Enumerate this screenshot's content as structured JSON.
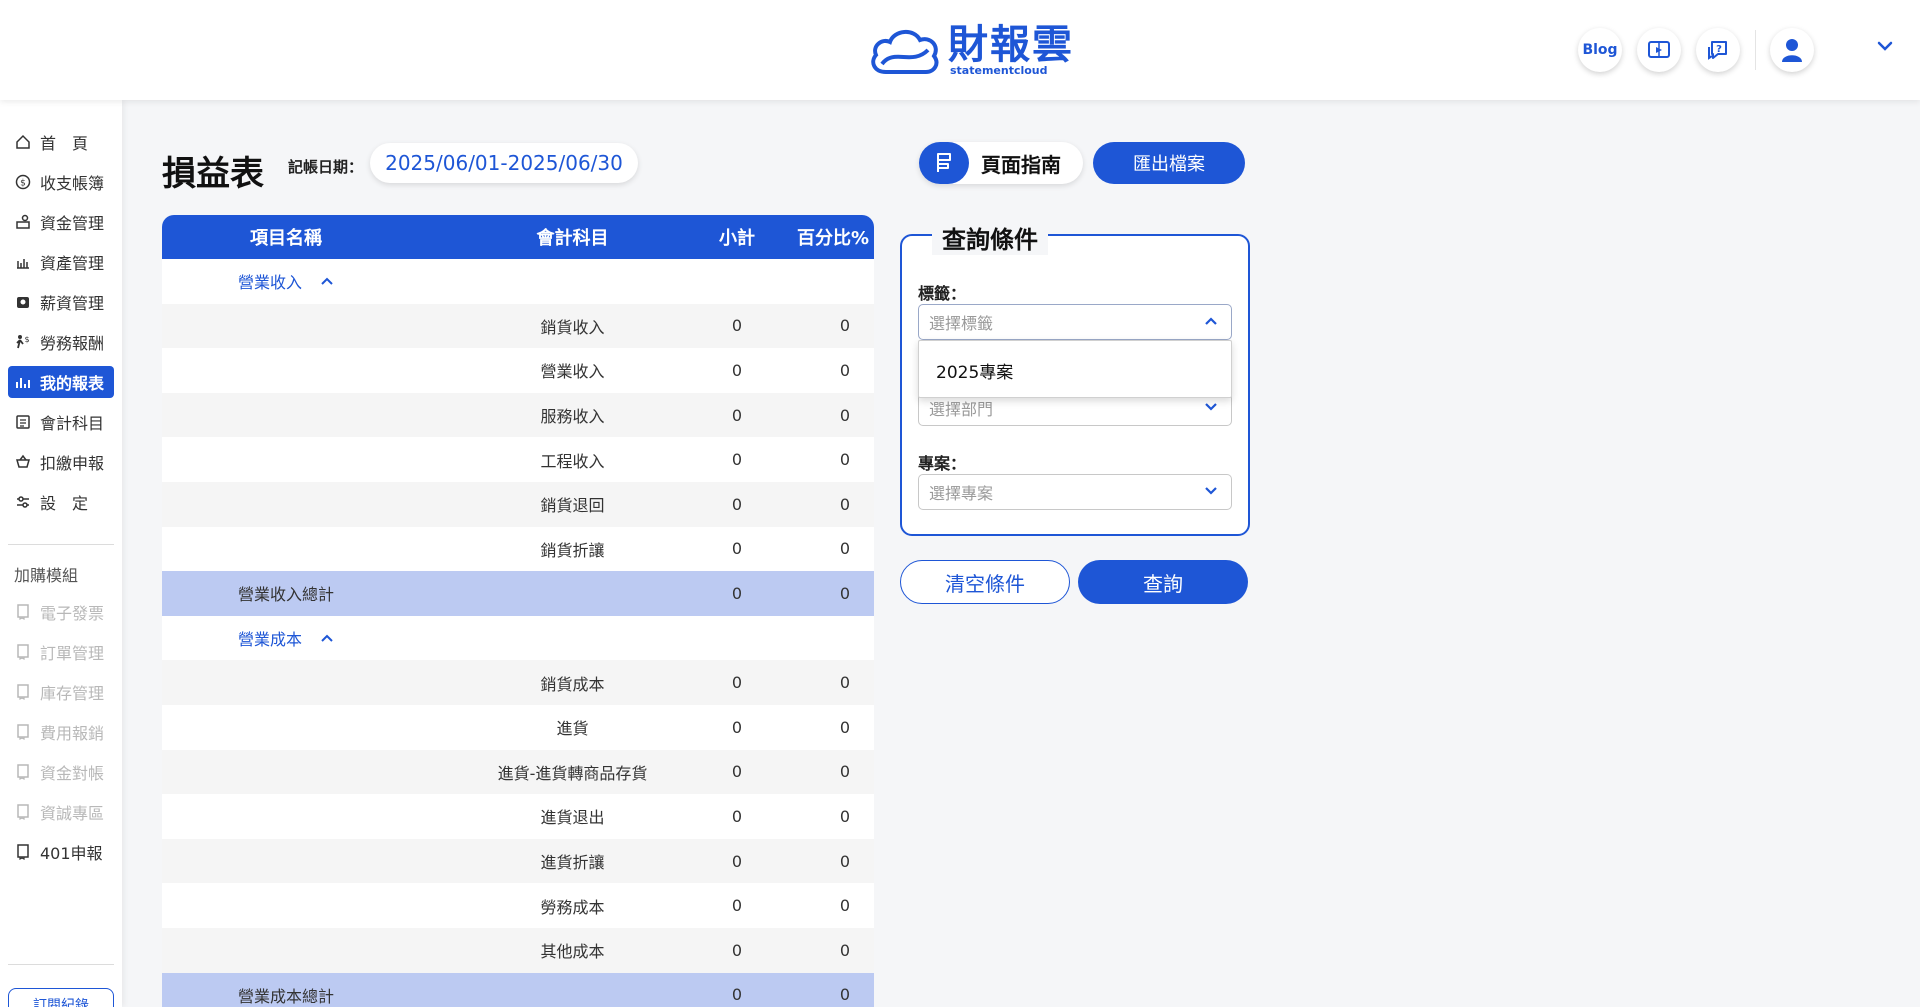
{
  "header": {
    "logo_cn": "財報雲",
    "logo_en": "statementcloud",
    "blog_label": "Blog",
    "icons": [
      "book-video-icon",
      "help-chat-icon",
      "user-icon",
      "chevron-down-icon"
    ],
    "accent": "#1e56d6"
  },
  "sidebar": {
    "items": [
      {
        "label": "首　頁",
        "icon": "home-icon"
      },
      {
        "label": "收支帳簿",
        "icon": "coin-icon"
      },
      {
        "label": "資金管理",
        "icon": "money-flow-icon"
      },
      {
        "label": "資產管理",
        "icon": "asset-icon"
      },
      {
        "label": "薪資管理",
        "icon": "salary-icon"
      },
      {
        "label": "勞務報酬",
        "icon": "labor-icon"
      },
      {
        "label": "我的報表",
        "icon": "chart-icon"
      },
      {
        "label": "會計科目",
        "icon": "accounts-icon"
      },
      {
        "label": "扣繳申報",
        "icon": "withholding-icon"
      },
      {
        "label": "設　定",
        "icon": "settings-icon"
      }
    ],
    "addon_section": "加購模組",
    "addons": [
      {
        "label": "電子發票"
      },
      {
        "label": "訂單管理"
      },
      {
        "label": "庫存管理"
      },
      {
        "label": "費用報銷"
      },
      {
        "label": "資金對帳"
      },
      {
        "label": "資誠專區"
      },
      {
        "label": "401申報"
      }
    ],
    "bottom_button": "訂閱紀錄"
  },
  "main": {
    "title": "損益表",
    "date_label": "記帳日期：",
    "date_range": "2025/06/01-2025/06/30",
    "guide_label": "頁面指南",
    "export_label": "匯出檔案"
  },
  "table": {
    "headers": [
      "項目名稱",
      "會計科目",
      "小計",
      "百分比%"
    ],
    "rows": [
      {
        "type": "group",
        "name": "營業收入",
        "account": "",
        "subtotal": "",
        "percent": ""
      },
      {
        "type": "row",
        "name": "",
        "account": "銷貨收入",
        "subtotal": "0",
        "percent": "0"
      },
      {
        "type": "row",
        "name": "",
        "account": "營業收入",
        "subtotal": "0",
        "percent": "0"
      },
      {
        "type": "row",
        "name": "",
        "account": "服務收入",
        "subtotal": "0",
        "percent": "0"
      },
      {
        "type": "row",
        "name": "",
        "account": "工程收入",
        "subtotal": "0",
        "percent": "0"
      },
      {
        "type": "row",
        "name": "",
        "account": "銷貨退回",
        "subtotal": "0",
        "percent": "0"
      },
      {
        "type": "row",
        "name": "",
        "account": "銷貨折讓",
        "subtotal": "0",
        "percent": "0"
      },
      {
        "type": "total",
        "name": "營業收入總計",
        "account": "",
        "subtotal": "0",
        "percent": "0"
      },
      {
        "type": "group",
        "name": "營業成本",
        "account": "",
        "subtotal": "",
        "percent": ""
      },
      {
        "type": "row",
        "name": "",
        "account": "銷貨成本",
        "subtotal": "0",
        "percent": "0"
      },
      {
        "type": "row",
        "name": "",
        "account": "進貨",
        "subtotal": "0",
        "percent": "0"
      },
      {
        "type": "row",
        "name": "",
        "account": "進貨-進貨轉商品存貨",
        "subtotal": "0",
        "percent": "0"
      },
      {
        "type": "row",
        "name": "",
        "account": "進貨退出",
        "subtotal": "0",
        "percent": "0"
      },
      {
        "type": "row",
        "name": "",
        "account": "進貨折讓",
        "subtotal": "0",
        "percent": "0"
      },
      {
        "type": "row",
        "name": "",
        "account": "勞務成本",
        "subtotal": "0",
        "percent": "0"
      },
      {
        "type": "row",
        "name": "",
        "account": "其他成本",
        "subtotal": "0",
        "percent": "0"
      },
      {
        "type": "total",
        "name": "營業成本總計",
        "account": "",
        "subtotal": "0",
        "percent": "0"
      }
    ]
  },
  "query": {
    "title": "查詢條件",
    "tag_label": "標籤：",
    "tag_placeholder": "選擇標籤",
    "tag_option": "2025專案",
    "dept_placeholder": "選擇部門",
    "project_label": "專案：",
    "project_placeholder": "選擇專案",
    "clear_label": "清空條件",
    "submit_label": "查詢"
  }
}
